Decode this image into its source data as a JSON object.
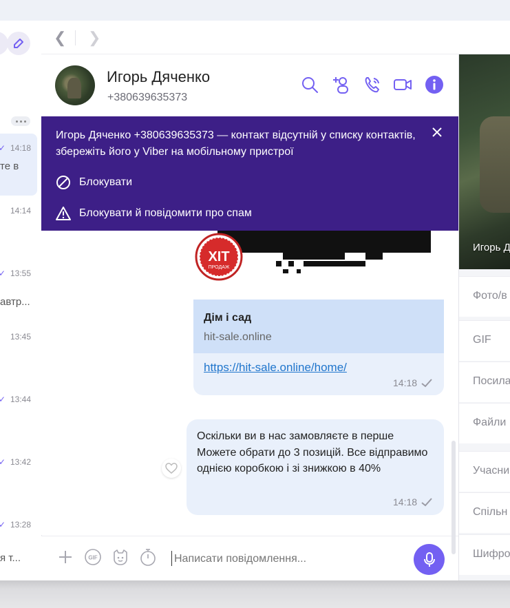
{
  "left_list": {
    "items": [
      {
        "time": "14:18",
        "snippet": "те в",
        "tick": "✓"
      },
      {
        "time": "14:14",
        "snippet": "",
        "tick": ""
      },
      {
        "time": "13:55",
        "snippet": "",
        "tick": "✓"
      },
      {
        "time": "13:45",
        "snippet": "автр...",
        "tick": ""
      },
      {
        "time": "13:44",
        "snippet": "",
        "tick": "✓"
      },
      {
        "time": "13:42",
        "snippet": "",
        "tick": "✓"
      },
      {
        "time": "13:28",
        "snippet": "я т...",
        "tick": "✓"
      }
    ]
  },
  "header": {
    "contact_name": "Игорь Дяченко",
    "contact_phone": "+380639635373"
  },
  "banner": {
    "message": "Игорь Дяченко +380639635373 — контакт відсутній у списку контактів, збережіть його у Viber на мобільному пристрої",
    "block_label": "Блокувати",
    "block_report_label": "Блокувати й повідомити про спам"
  },
  "messages": {
    "link_preview": {
      "badge_text": "ХІТ",
      "badge_sub": "ПРОДАЖ",
      "title": "Дім і сад",
      "domain": "hit-sale.online",
      "url": "https://hit-sale.online/home/",
      "time": "14:18"
    },
    "text_message": {
      "text": "Оскільки ви в нас замовляєте в перше Можете обрати до 3 позицій. Все відправимо однією коробкою і зі знижкою в 40%",
      "time": "14:18"
    }
  },
  "composer": {
    "placeholder": "Написати повідомлення..."
  },
  "right_panel": {
    "name": "Игорь Д",
    "items": [
      "Фото/в",
      "GIF",
      "Посила",
      "Файли",
      "Учасни",
      "Спільн",
      "Шифро"
    ]
  },
  "colors": {
    "accent": "#7360f2",
    "banner": "#3d1f87",
    "bubble": "#e9f0fb",
    "link_meta": "#cfe0f8"
  }
}
